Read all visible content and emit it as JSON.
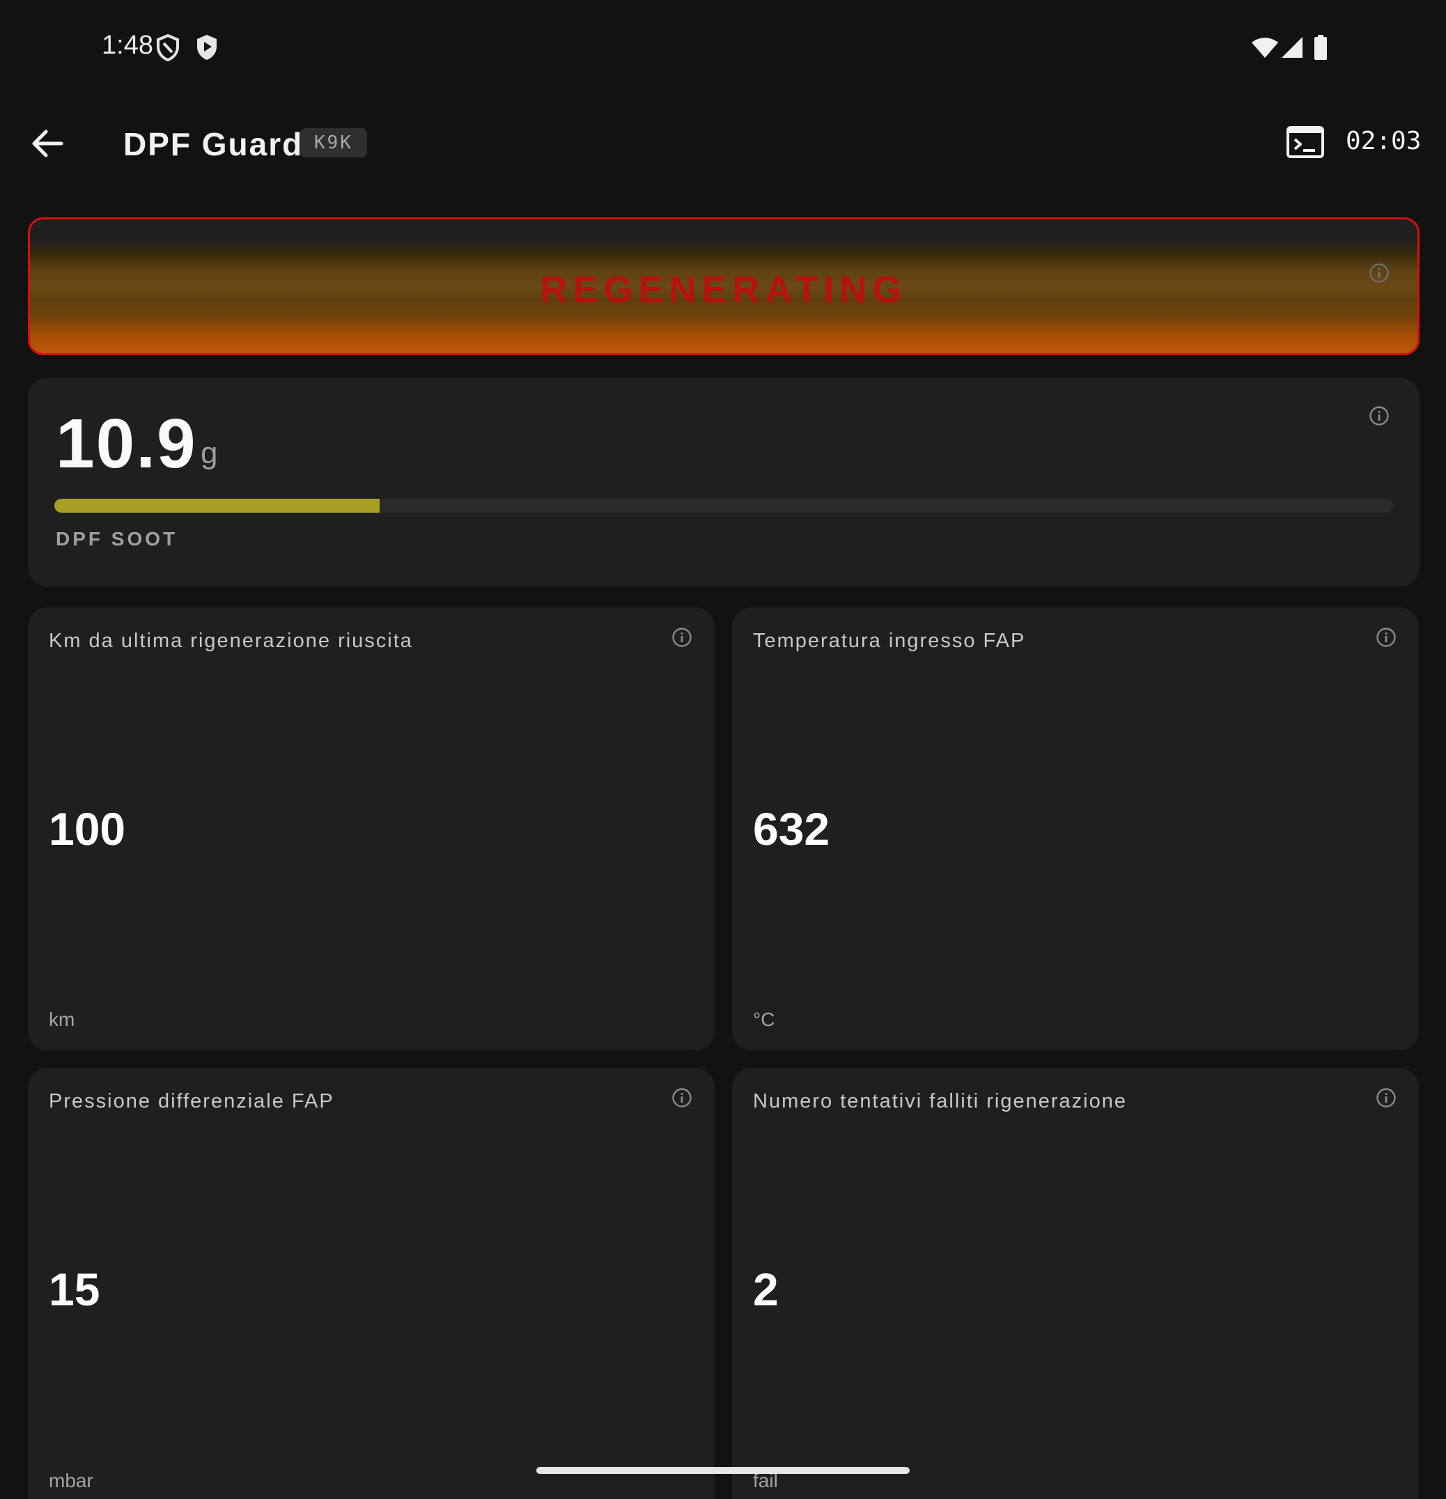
{
  "status_bar": {
    "time": "1:48"
  },
  "app_bar": {
    "title": "DPF Guard",
    "engine_code": "K9K",
    "elapsed": "02:03"
  },
  "banner": {
    "text": "REGENERATING",
    "border_color": "#d1130d",
    "text_color": "#b8120c"
  },
  "soot": {
    "value": "10.9",
    "unit": "g",
    "label": "DPF SOOT",
    "progress_fraction": 0.243,
    "bar_color": "#a8a024"
  },
  "metrics": [
    {
      "title": "Km da ultima rigenerazione riuscita",
      "value": "100",
      "unit": "km"
    },
    {
      "title": "Temperatura ingresso FAP",
      "value": "632",
      "unit": "°C"
    },
    {
      "title": "Pressione differenziale FAP",
      "value": "15",
      "unit": "mbar"
    },
    {
      "title": "Numero tentativi falliti rigenerazione",
      "value": "2",
      "unit": "fail"
    }
  ]
}
